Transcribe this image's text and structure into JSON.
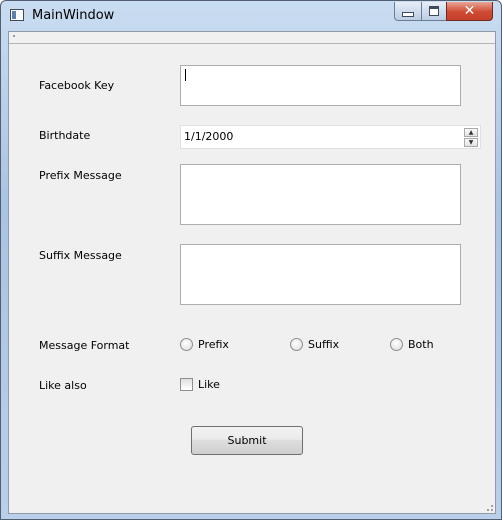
{
  "window": {
    "title": "MainWindow"
  },
  "form": {
    "facebook_key": {
      "label": "Facebook Key",
      "value": ""
    },
    "birthdate": {
      "label": "Birthdate",
      "value": "1/1/2000"
    },
    "prefix_message": {
      "label": "Prefix Message",
      "value": ""
    },
    "suffix_message": {
      "label": "Suffix Message",
      "value": ""
    },
    "message_format": {
      "label": "Message Format",
      "options": [
        "Prefix",
        "Suffix",
        "Both"
      ],
      "selected": null
    },
    "like_also": {
      "label": "Like also",
      "checkbox_label": "Like",
      "checked": false
    },
    "submit_label": "Submit"
  },
  "colors": {
    "close_button": "#cf4a32",
    "client_background": "#f0f0f0",
    "field_border": "#abadb3"
  }
}
